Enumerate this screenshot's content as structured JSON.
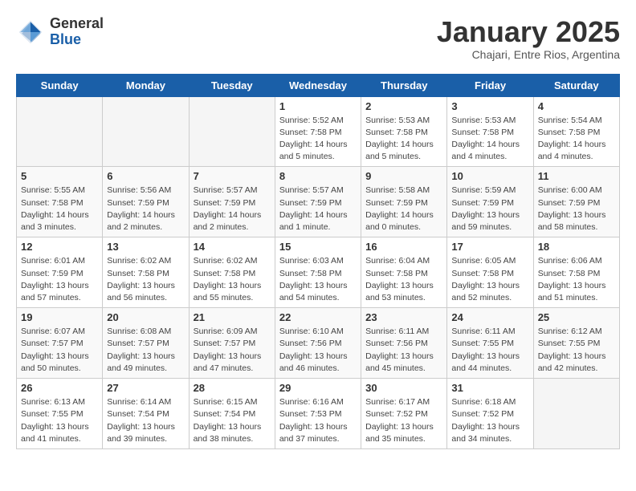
{
  "header": {
    "logo_line1": "General",
    "logo_line2": "Blue",
    "title": "January 2025",
    "subtitle": "Chajari, Entre Rios, Argentina"
  },
  "weekdays": [
    "Sunday",
    "Monday",
    "Tuesday",
    "Wednesday",
    "Thursday",
    "Friday",
    "Saturday"
  ],
  "weeks": [
    [
      {
        "day": "",
        "info": ""
      },
      {
        "day": "",
        "info": ""
      },
      {
        "day": "",
        "info": ""
      },
      {
        "day": "1",
        "info": "Sunrise: 5:52 AM\nSunset: 7:58 PM\nDaylight: 14 hours\nand 5 minutes."
      },
      {
        "day": "2",
        "info": "Sunrise: 5:53 AM\nSunset: 7:58 PM\nDaylight: 14 hours\nand 5 minutes."
      },
      {
        "day": "3",
        "info": "Sunrise: 5:53 AM\nSunset: 7:58 PM\nDaylight: 14 hours\nand 4 minutes."
      },
      {
        "day": "4",
        "info": "Sunrise: 5:54 AM\nSunset: 7:58 PM\nDaylight: 14 hours\nand 4 minutes."
      }
    ],
    [
      {
        "day": "5",
        "info": "Sunrise: 5:55 AM\nSunset: 7:58 PM\nDaylight: 14 hours\nand 3 minutes."
      },
      {
        "day": "6",
        "info": "Sunrise: 5:56 AM\nSunset: 7:59 PM\nDaylight: 14 hours\nand 2 minutes."
      },
      {
        "day": "7",
        "info": "Sunrise: 5:57 AM\nSunset: 7:59 PM\nDaylight: 14 hours\nand 2 minutes."
      },
      {
        "day": "8",
        "info": "Sunrise: 5:57 AM\nSunset: 7:59 PM\nDaylight: 14 hours\nand 1 minute."
      },
      {
        "day": "9",
        "info": "Sunrise: 5:58 AM\nSunset: 7:59 PM\nDaylight: 14 hours\nand 0 minutes."
      },
      {
        "day": "10",
        "info": "Sunrise: 5:59 AM\nSunset: 7:59 PM\nDaylight: 13 hours\nand 59 minutes."
      },
      {
        "day": "11",
        "info": "Sunrise: 6:00 AM\nSunset: 7:59 PM\nDaylight: 13 hours\nand 58 minutes."
      }
    ],
    [
      {
        "day": "12",
        "info": "Sunrise: 6:01 AM\nSunset: 7:59 PM\nDaylight: 13 hours\nand 57 minutes."
      },
      {
        "day": "13",
        "info": "Sunrise: 6:02 AM\nSunset: 7:58 PM\nDaylight: 13 hours\nand 56 minutes."
      },
      {
        "day": "14",
        "info": "Sunrise: 6:02 AM\nSunset: 7:58 PM\nDaylight: 13 hours\nand 55 minutes."
      },
      {
        "day": "15",
        "info": "Sunrise: 6:03 AM\nSunset: 7:58 PM\nDaylight: 13 hours\nand 54 minutes."
      },
      {
        "day": "16",
        "info": "Sunrise: 6:04 AM\nSunset: 7:58 PM\nDaylight: 13 hours\nand 53 minutes."
      },
      {
        "day": "17",
        "info": "Sunrise: 6:05 AM\nSunset: 7:58 PM\nDaylight: 13 hours\nand 52 minutes."
      },
      {
        "day": "18",
        "info": "Sunrise: 6:06 AM\nSunset: 7:58 PM\nDaylight: 13 hours\nand 51 minutes."
      }
    ],
    [
      {
        "day": "19",
        "info": "Sunrise: 6:07 AM\nSunset: 7:57 PM\nDaylight: 13 hours\nand 50 minutes."
      },
      {
        "day": "20",
        "info": "Sunrise: 6:08 AM\nSunset: 7:57 PM\nDaylight: 13 hours\nand 49 minutes."
      },
      {
        "day": "21",
        "info": "Sunrise: 6:09 AM\nSunset: 7:57 PM\nDaylight: 13 hours\nand 47 minutes."
      },
      {
        "day": "22",
        "info": "Sunrise: 6:10 AM\nSunset: 7:56 PM\nDaylight: 13 hours\nand 46 minutes."
      },
      {
        "day": "23",
        "info": "Sunrise: 6:11 AM\nSunset: 7:56 PM\nDaylight: 13 hours\nand 45 minutes."
      },
      {
        "day": "24",
        "info": "Sunrise: 6:11 AM\nSunset: 7:55 PM\nDaylight: 13 hours\nand 44 minutes."
      },
      {
        "day": "25",
        "info": "Sunrise: 6:12 AM\nSunset: 7:55 PM\nDaylight: 13 hours\nand 42 minutes."
      }
    ],
    [
      {
        "day": "26",
        "info": "Sunrise: 6:13 AM\nSunset: 7:55 PM\nDaylight: 13 hours\nand 41 minutes."
      },
      {
        "day": "27",
        "info": "Sunrise: 6:14 AM\nSunset: 7:54 PM\nDaylight: 13 hours\nand 39 minutes."
      },
      {
        "day": "28",
        "info": "Sunrise: 6:15 AM\nSunset: 7:54 PM\nDaylight: 13 hours\nand 38 minutes."
      },
      {
        "day": "29",
        "info": "Sunrise: 6:16 AM\nSunset: 7:53 PM\nDaylight: 13 hours\nand 37 minutes."
      },
      {
        "day": "30",
        "info": "Sunrise: 6:17 AM\nSunset: 7:52 PM\nDaylight: 13 hours\nand 35 minutes."
      },
      {
        "day": "31",
        "info": "Sunrise: 6:18 AM\nSunset: 7:52 PM\nDaylight: 13 hours\nand 34 minutes."
      },
      {
        "day": "",
        "info": ""
      }
    ]
  ]
}
